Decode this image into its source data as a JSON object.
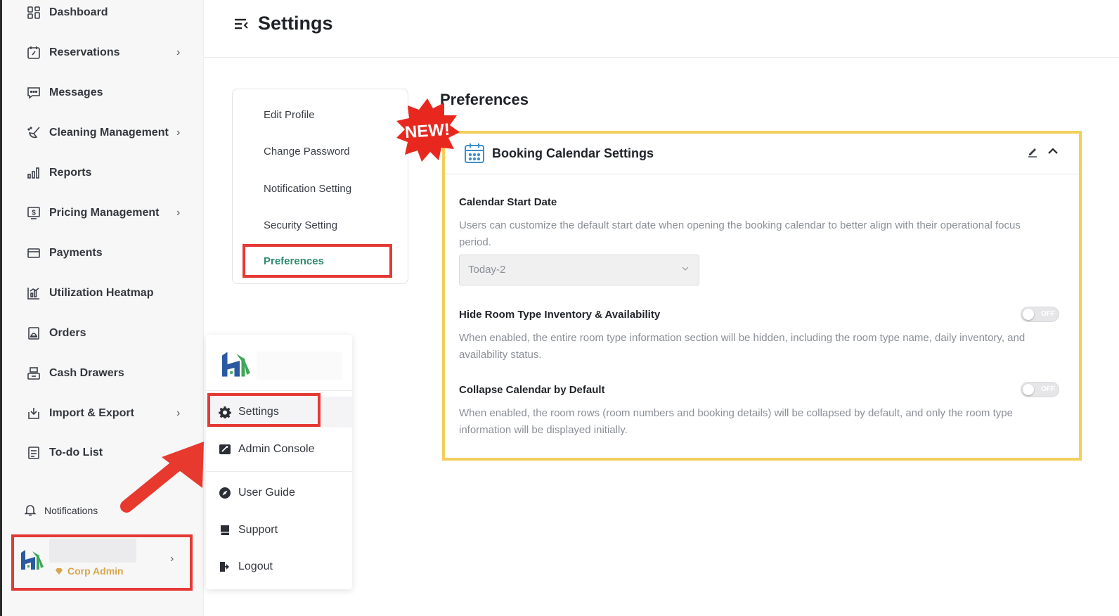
{
  "header": {
    "title": "Settings",
    "icon": "menu-collapse-icon"
  },
  "sidebar": {
    "items": [
      {
        "label": "Dashboard",
        "icon": "dashboard-icon",
        "has_submenu": false
      },
      {
        "label": "Reservations",
        "icon": "calendar-icon",
        "has_submenu": true
      },
      {
        "label": "Messages",
        "icon": "message-icon",
        "has_submenu": false
      },
      {
        "label": "Cleaning Management",
        "icon": "broom-icon",
        "has_submenu": true
      },
      {
        "label": "Reports",
        "icon": "bar-chart-icon",
        "has_submenu": false
      },
      {
        "label": "Pricing Management",
        "icon": "dollar-icon",
        "has_submenu": true
      },
      {
        "label": "Payments",
        "icon": "card-icon",
        "has_submenu": false
      },
      {
        "label": "Utilization Heatmap",
        "icon": "heatmap-icon",
        "has_submenu": false
      },
      {
        "label": "Orders",
        "icon": "orders-icon",
        "has_submenu": false
      },
      {
        "label": "Cash Drawers",
        "icon": "cash-drawer-icon",
        "has_submenu": false
      },
      {
        "label": "Import & Export",
        "icon": "import-export-icon",
        "has_submenu": true
      },
      {
        "label": "To-do List",
        "icon": "todo-icon",
        "has_submenu": false
      }
    ],
    "notifications_label": "Notifications",
    "user": {
      "role": "Corp Admin"
    }
  },
  "settings_menu": {
    "items": [
      "Edit Profile",
      "Change Password",
      "Notification Setting",
      "Security Setting"
    ],
    "active": "Preferences"
  },
  "preferences": {
    "heading": "Preferences",
    "badge": "NEW!",
    "card_title": "Booking Calendar Settings",
    "calendar_start": {
      "title": "Calendar Start Date",
      "desc": "Users can customize the default start date when opening the booking calendar to better align with their operational focus period.",
      "value": "Today-2"
    },
    "hide_room": {
      "title": "Hide Room Type Inventory & Availability",
      "desc": "When enabled, the entire room type information section will be hidden, including the room type name, daily inventory, and availability status.",
      "toggle": "OFF"
    },
    "collapse_calendar": {
      "title": "Collapse Calendar by Default",
      "desc": "When enabled, the room rows (room numbers and booking details) will be collapsed by default, and only the room type information will be displayed initially.",
      "toggle": "OFF"
    }
  },
  "popup_menu": {
    "items": [
      "Settings",
      "Admin Console",
      "User Guide",
      "Support",
      "Logout"
    ]
  },
  "colors": {
    "accent_green": "#2e8b6e",
    "highlight_red": "#e53935",
    "highlight_yellow": "#f2cf5b",
    "badge_red": "#e8281e",
    "corp_gold": "#d8a64a"
  }
}
